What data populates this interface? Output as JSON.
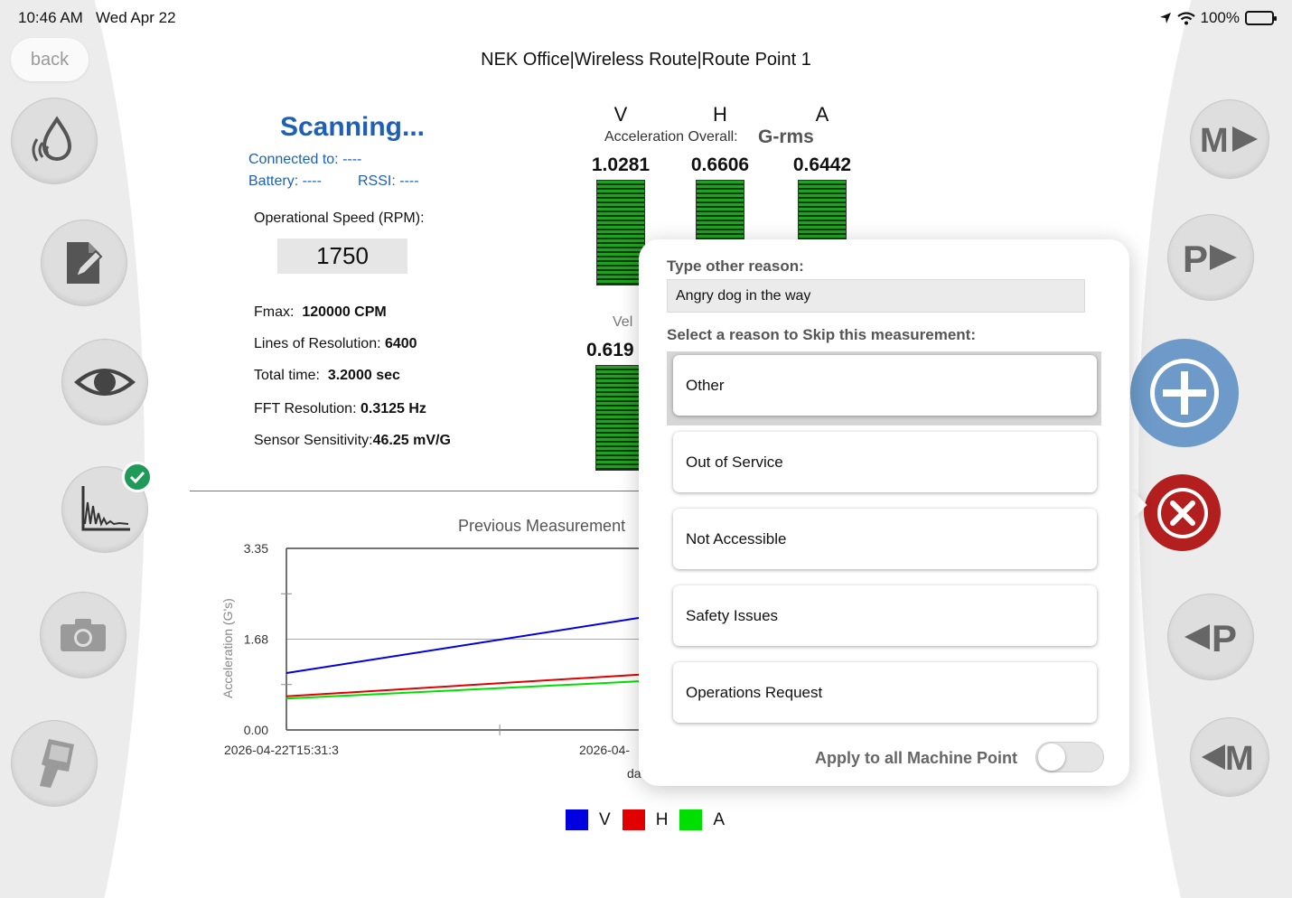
{
  "status_bar": {
    "time": "10:46 AM",
    "date": "Wed Apr 22",
    "battery": "100%"
  },
  "nav": {
    "back_label": "back",
    "title": "NEK Office|Wireless Route|Route Point 1"
  },
  "left_toolbar": {
    "icons": [
      "vibration-sensor-icon",
      "edit-note-icon",
      "eye-icon",
      "spectrum-chart-icon",
      "camera-icon",
      "handheld-device-icon"
    ],
    "spectrum_completed": true
  },
  "right_toolbar": {
    "next_machine_label": "M",
    "next_point_label": "P",
    "previous_point_label": "P",
    "previous_machine_label": "M",
    "add_color": "#6d9ac8",
    "cancel_color": "#b31f1f"
  },
  "scan": {
    "status": "Scanning...",
    "connected_to": "Connected to: ----",
    "battery": "Battery: ----",
    "rssi": "RSSI: ----"
  },
  "settings": {
    "speed_label": "Operational Speed (RPM):",
    "speed_value": "1750",
    "fmax_label": "Fmax:",
    "fmax_value": "120000 CPM",
    "lines_label": "Lines of Resolution:",
    "lines_value": "6400",
    "total_time_label": "Total time:",
    "total_time_value": "3.2000 sec",
    "fft_label": "FFT Resolution:",
    "fft_value": "0.3125 Hz",
    "sensitivity_label": "Sensor Sensitivity:",
    "sensitivity_value": "46.25 mV/G"
  },
  "overall": {
    "axes": [
      "V",
      "H",
      "A"
    ],
    "label": "Acceleration Overall:",
    "unit": "G-rms",
    "values": [
      "1.0281",
      "0.6606",
      "0.6442"
    ],
    "velocity_label": "Vel",
    "velocity_value": "0.619"
  },
  "chart_data": {
    "type": "line",
    "title": "Previous Measurement",
    "xlabel": "da",
    "ylabel": "Acceleration (G's)",
    "x_ticks": [
      "2026-04-22T15:31:3",
      "2026-04-"
    ],
    "y_ticks": [
      "3.35",
      "1.68",
      "0.00"
    ],
    "ylim": [
      0,
      3.35
    ],
    "x": [
      0,
      1
    ],
    "series": [
      {
        "name": "V",
        "color": "#0000e0",
        "values": [
          1.05,
          2.75
        ]
      },
      {
        "name": "H",
        "color": "#e00000",
        "values": [
          0.62,
          1.29
        ]
      },
      {
        "name": "A",
        "color": "#00e000",
        "values": [
          0.58,
          1.11
        ]
      }
    ]
  },
  "skip_dialog": {
    "other_reason_label": "Type other reason:",
    "other_reason_value": "Angry dog in the way",
    "select_label": "Select a reason to Skip this measurement:",
    "reasons": [
      "Other",
      "Out of Service",
      "Not Accessible",
      "Safety Issues",
      "Operations Request"
    ],
    "selected_reason": "Other",
    "apply_all_label": "Apply to all Machine Point",
    "apply_all_on": false
  }
}
